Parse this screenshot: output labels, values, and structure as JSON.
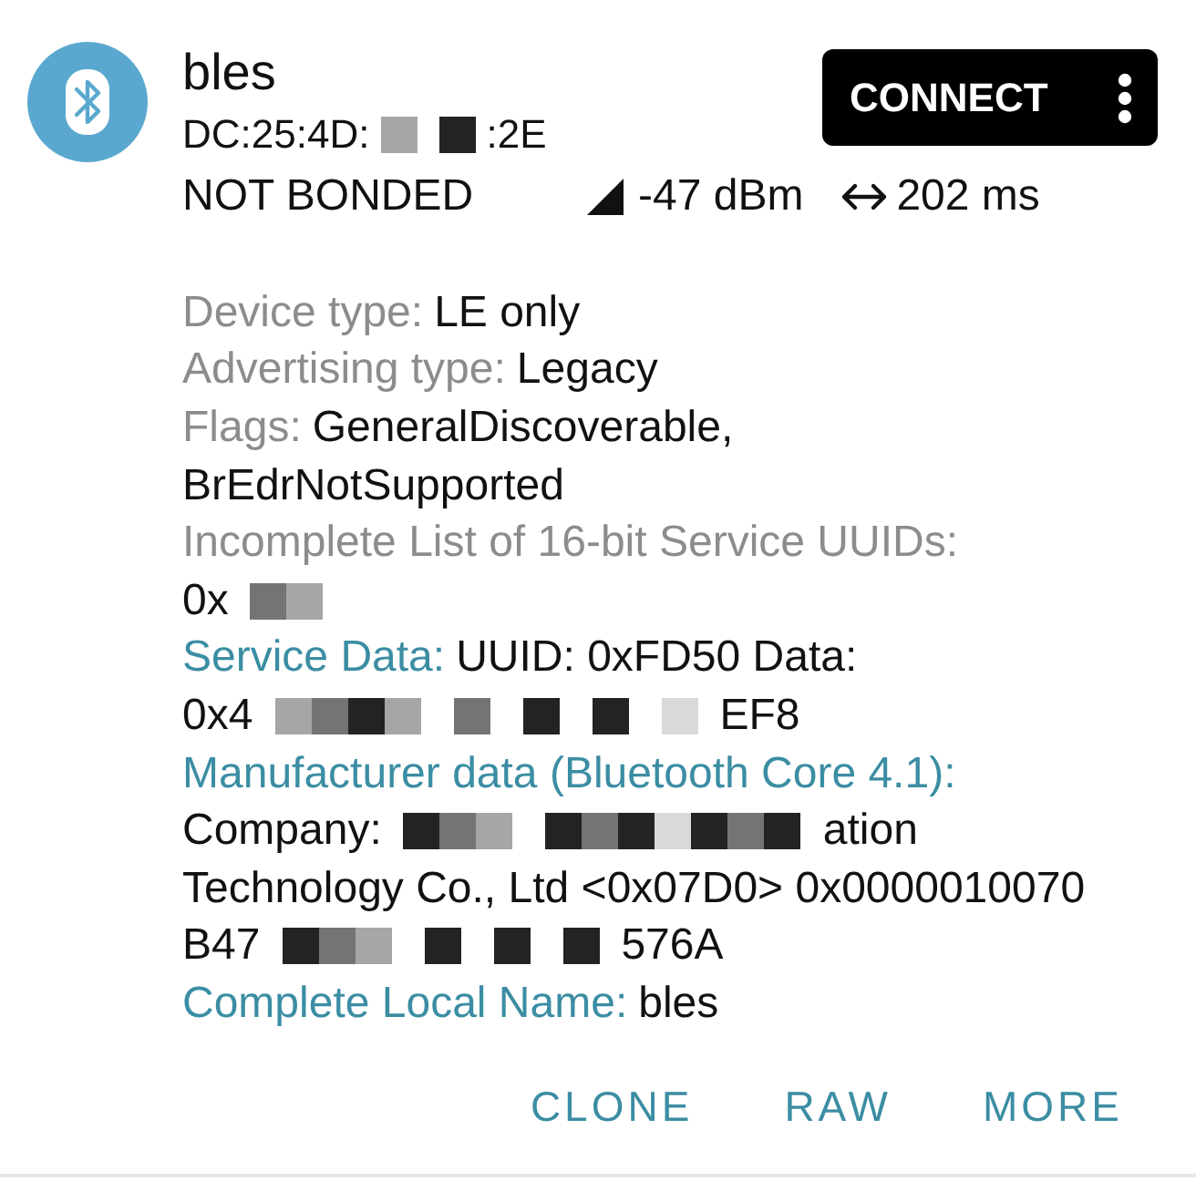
{
  "device": {
    "name": "bles",
    "address": [
      {
        "kind": "text",
        "text": "DC:25:4D:"
      },
      {
        "kind": "mosaic",
        "tiles": [
          {
            "kind": "light"
          }
        ]
      },
      {
        "kind": "mosaic",
        "tiles": [
          {
            "kind": "dark"
          }
        ]
      },
      {
        "kind": "text",
        "text": ":2E"
      }
    ],
    "bond_state": "NOT BONDED",
    "rssi": "-47 dBm",
    "interval": "202 ms"
  },
  "connect_button": "CONNECT",
  "details": [
    {
      "kind": "field",
      "label": "Device type:",
      "value": [
        {
          "kind": "text",
          "text": "LE only"
        }
      ]
    },
    {
      "kind": "field",
      "label": "Advertising type:",
      "value": [
        {
          "kind": "text",
          "text": "Legacy"
        }
      ]
    },
    {
      "kind": "field",
      "label": "Flags:",
      "value": [
        {
          "kind": "text",
          "text": "GeneralDiscoverable,"
        },
        {
          "kind": "break"
        },
        {
          "kind": "text",
          "text": "BrEdrNotSupported"
        }
      ]
    },
    {
      "kind": "field",
      "label": "Incomplete List of 16-bit Service UUIDs:",
      "value": [
        {
          "kind": "break"
        },
        {
          "kind": "text",
          "text": "0x"
        },
        {
          "kind": "mosaic",
          "tiles": [
            {
              "kind": "mid"
            },
            {
              "kind": "light"
            }
          ]
        }
      ]
    },
    {
      "kind": "section",
      "label": "Service Data:",
      "value": [
        {
          "kind": "text",
          "text": "UUID: 0xFD50 Data:"
        },
        {
          "kind": "break"
        },
        {
          "kind": "text",
          "text": "0x4"
        },
        {
          "kind": "mosaic",
          "tiles": [
            {
              "kind": "light"
            },
            {
              "kind": "mid"
            },
            {
              "kind": "dark"
            },
            {
              "kind": "light"
            }
          ]
        },
        {
          "kind": "mosaic",
          "tiles": [
            {
              "kind": "mid"
            }
          ]
        },
        {
          "kind": "mosaic",
          "tiles": [
            {
              "kind": "dark"
            }
          ]
        },
        {
          "kind": "mosaic",
          "tiles": [
            {
              "kind": "dark"
            }
          ]
        },
        {
          "kind": "mosaic",
          "tiles": [
            {
              "kind": "pale"
            }
          ]
        },
        {
          "kind": "text",
          "text": "EF8"
        }
      ]
    },
    {
      "kind": "section",
      "label": "Manufacturer data (Bluetooth Core 4.1):",
      "value": [
        {
          "kind": "break"
        },
        {
          "kind": "text",
          "text": "Company:"
        },
        {
          "kind": "mosaic",
          "tiles": [
            {
              "kind": "dark"
            },
            {
              "kind": "mid"
            },
            {
              "kind": "light"
            }
          ]
        },
        {
          "kind": "mosaic",
          "tiles": [
            {
              "kind": "dark"
            },
            {
              "kind": "mid"
            },
            {
              "kind": "dark"
            },
            {
              "kind": "pale"
            },
            {
              "kind": "dark"
            },
            {
              "kind": "mid"
            },
            {
              "kind": "dark"
            }
          ]
        },
        {
          "kind": "text",
          "text": "ation"
        },
        {
          "kind": "break"
        },
        {
          "kind": "text",
          "text": "Technology Co., Ltd <0x07D0> 0x0000010070"
        },
        {
          "kind": "break"
        },
        {
          "kind": "text",
          "text": "B47"
        },
        {
          "kind": "mosaic",
          "tiles": [
            {
              "kind": "dark"
            },
            {
              "kind": "mid"
            },
            {
              "kind": "light"
            }
          ]
        },
        {
          "kind": "mosaic",
          "tiles": [
            {
              "kind": "dark"
            }
          ]
        },
        {
          "kind": "mosaic",
          "tiles": [
            {
              "kind": "dark"
            }
          ]
        },
        {
          "kind": "mosaic",
          "tiles": [
            {
              "kind": "dark"
            }
          ]
        },
        {
          "kind": "text",
          "text": "576A"
        }
      ]
    },
    {
      "kind": "section",
      "label": "Complete Local Name:",
      "value": [
        {
          "kind": "text",
          "text": "bles"
        }
      ]
    }
  ],
  "buttons": [
    "CLONE",
    "RAW",
    "MORE"
  ]
}
